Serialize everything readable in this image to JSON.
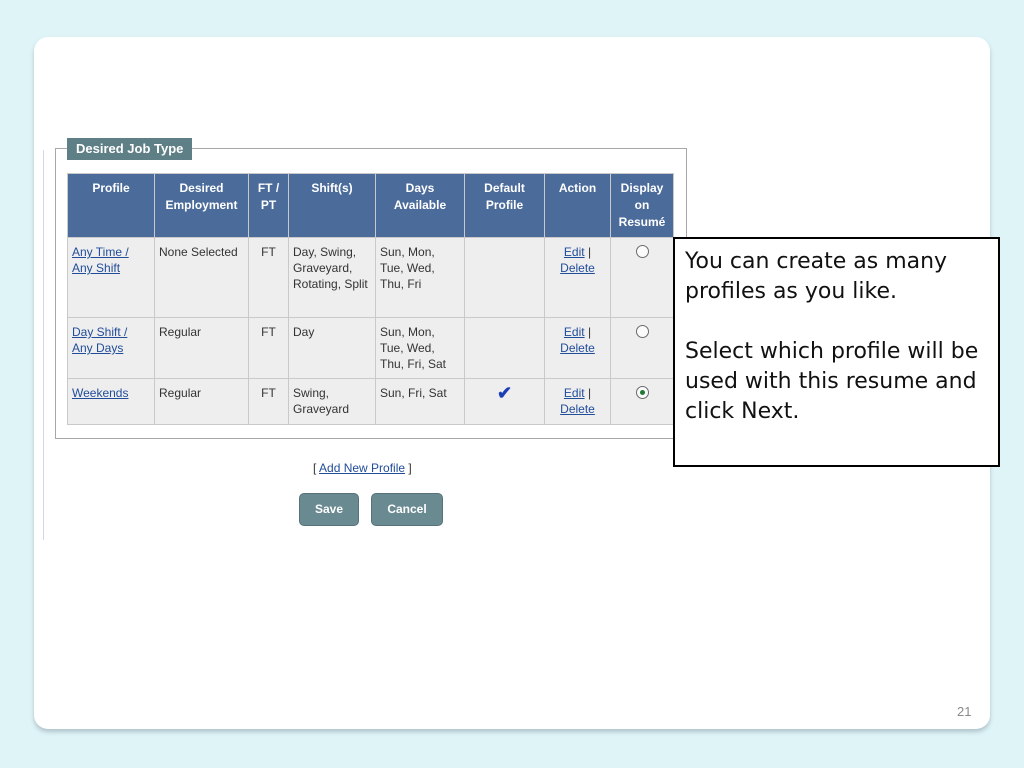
{
  "section_title": "Desired Job Type",
  "table": {
    "headers": [
      "Profile",
      "Desired Employment",
      "FT / PT",
      "Shift(s)",
      "Days Available",
      "Default Profile",
      "Action",
      "Display on Resumé"
    ],
    "rows": [
      {
        "profile": "Any Time / Any Shift",
        "employment": "None Selected",
        "ftpt": "FT",
        "shifts": "Day, Swing, Graveyard, Rotating, Split",
        "days": "Sun, Mon, Tue, Wed, Thu, Fri",
        "default": false,
        "display_selected": false
      },
      {
        "profile": "Day Shift / Any Days",
        "employment": "Regular",
        "ftpt": "FT",
        "shifts": "Day",
        "days": "Sun, Mon, Tue, Wed, Thu, Fri, Sat",
        "default": false,
        "display_selected": false
      },
      {
        "profile": "Weekends",
        "employment": "Regular",
        "ftpt": "FT",
        "shifts": "Swing, Graveyard",
        "days": "Sun, Fri, Sat",
        "default": true,
        "display_selected": true
      }
    ],
    "action_edit": "Edit",
    "action_separator": "|",
    "action_delete": "Delete"
  },
  "add_profile": {
    "open": "[",
    "label": "Add New Profile",
    "close": "]"
  },
  "buttons": {
    "save": "Save",
    "cancel": "Cancel"
  },
  "callout": {
    "line1": "You can create as many profiles as you like.",
    "line2": "Select which profile will be used with this resume and click Next."
  },
  "page_number": "21",
  "colors": {
    "header_bg": "#4b6c9b",
    "legend_bg": "#5f7f86",
    "button_bg": "#6a8a91",
    "link": "#224d9a",
    "background": "#dff4f7"
  }
}
